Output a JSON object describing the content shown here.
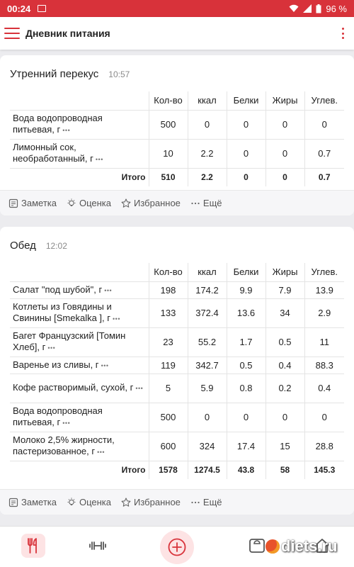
{
  "status_bar": {
    "time": "00:24",
    "battery": "96 %"
  },
  "app_bar": {
    "title": "Дневник питания"
  },
  "columns": [
    "Кол-во",
    "ккал",
    "Белки",
    "Жиры",
    "Углев."
  ],
  "meals": [
    {
      "name": "Утренний перекус",
      "time": "10:57",
      "rows": [
        {
          "name": "Вода водопроводная питьевая, г",
          "values": [
            "500",
            "0",
            "0",
            "0",
            "0"
          ]
        },
        {
          "name": "Лимонный сок, необработанный, г",
          "values": [
            "10",
            "2.2",
            "0",
            "0",
            "0.7"
          ]
        }
      ],
      "total": {
        "label": "Итого",
        "values": [
          "510",
          "2.2",
          "0",
          "0",
          "0.7"
        ]
      }
    },
    {
      "name": "Обед",
      "time": "12:02",
      "rows": [
        {
          "name": "Салат \"под шубой\", г",
          "values": [
            "198",
            "174.2",
            "9.9",
            "7.9",
            "13.9"
          ]
        },
        {
          "name": "Котлеты из Говядины и Свинины [Smekalka ], г",
          "values": [
            "133",
            "372.4",
            "13.6",
            "34",
            "2.9"
          ]
        },
        {
          "name": "Багет Французский [Томин Хлеб], г",
          "values": [
            "23",
            "55.2",
            "1.7",
            "0.5",
            "11"
          ]
        },
        {
          "name": "Варенье из сливы, г",
          "values": [
            "119",
            "342.7",
            "0.5",
            "0.4",
            "88.3"
          ]
        },
        {
          "name": "Кофе растворимый, сухой, г",
          "values": [
            "5",
            "5.9",
            "0.8",
            "0.2",
            "0.4"
          ]
        },
        {
          "name": "Вода водопроводная питьевая, г",
          "values": [
            "500",
            "0",
            "0",
            "0",
            "0"
          ]
        },
        {
          "name": "Молоко 2,5% жирности, пастеризованное, г",
          "values": [
            "600",
            "324",
            "17.4",
            "15",
            "28.8"
          ]
        }
      ],
      "total": {
        "label": "Итого",
        "values": [
          "1578",
          "1274.5",
          "43.8",
          "58",
          "145.3"
        ]
      }
    }
  ],
  "actions": {
    "note": "Заметка",
    "rating": "Оценка",
    "favorite": "Избранное",
    "more": "Ещё"
  },
  "row_menu": "•••",
  "watermark": {
    "text": "diets.ru"
  },
  "colors": {
    "accent": "#d8323a",
    "accent_light": "#fde3e4"
  },
  "icons": {
    "status": [
      "image-icon",
      "wifi-icon",
      "signal-icon",
      "battery-icon"
    ],
    "app_bar": [
      "menu-icon",
      "more-vert-icon"
    ],
    "actions": [
      "note-icon",
      "bulb-icon",
      "star-icon",
      "more-horiz-icon"
    ],
    "nav": [
      "cutlery-icon",
      "dumbbell-icon",
      "plus-circle-icon",
      "scale-icon",
      "home-icon"
    ]
  }
}
